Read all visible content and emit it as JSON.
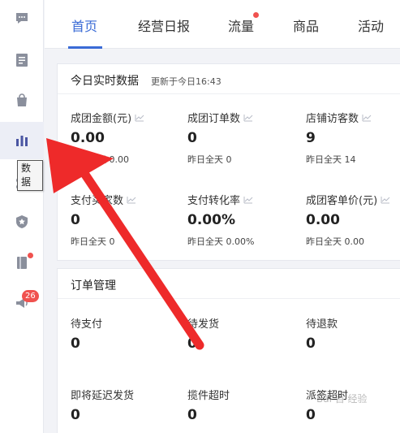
{
  "sidebar": {
    "items": [
      {
        "icon": "chat-icon"
      },
      {
        "icon": "document-icon"
      },
      {
        "icon": "shopping-bag-icon"
      },
      {
        "icon": "bar-chart-icon",
        "active": true
      },
      {
        "icon": "apps-icon"
      },
      {
        "icon": "shield-icon"
      },
      {
        "icon": "book-icon",
        "dot": true
      },
      {
        "icon": "speaker-icon",
        "badge": "26"
      }
    ],
    "tooltip": "数据"
  },
  "tabs": [
    {
      "label": "首页",
      "active": true
    },
    {
      "label": "经营日报"
    },
    {
      "label": "流量",
      "dot": true
    },
    {
      "label": "商品"
    },
    {
      "label": "活动"
    }
  ],
  "realtime": {
    "title": "今日实时数据",
    "updated": "更新于今日16:43",
    "metrics": [
      {
        "label": "成团金额(元)",
        "value": "0.00",
        "prev": "昨日全天 0.00"
      },
      {
        "label": "成团订单数",
        "value": "0",
        "prev": "昨日全天 0"
      },
      {
        "label": "店铺访客数",
        "value": "9",
        "prev": "昨日全天 14"
      },
      {
        "label": "支付买家数",
        "value": "0",
        "prev": "昨日全天 0"
      },
      {
        "label": "支付转化率",
        "value": "0.00%",
        "prev": "昨日全天 0.00%"
      },
      {
        "label": "成团客单价(元)",
        "value": "0.00",
        "prev": "昨日全天 0.00"
      }
    ]
  },
  "orders": {
    "title": "订单管理",
    "items": [
      {
        "label": "待支付",
        "value": "0"
      },
      {
        "label": "待发货",
        "value": "0"
      },
      {
        "label": "待退款",
        "value": "0"
      },
      {
        "label": "即将延迟发货",
        "value": "0"
      },
      {
        "label": "揽件超时",
        "value": "0"
      },
      {
        "label": "派签超时",
        "value": "0"
      }
    ]
  },
  "watermark": "Bai 百 经验",
  "colors": {
    "accent": "#3a6bd6",
    "alert": "#f0524f",
    "sidebar_icon": "#8a8f9c",
    "active_icon": "#4a55a2",
    "arrow": "#ee2a2a"
  }
}
